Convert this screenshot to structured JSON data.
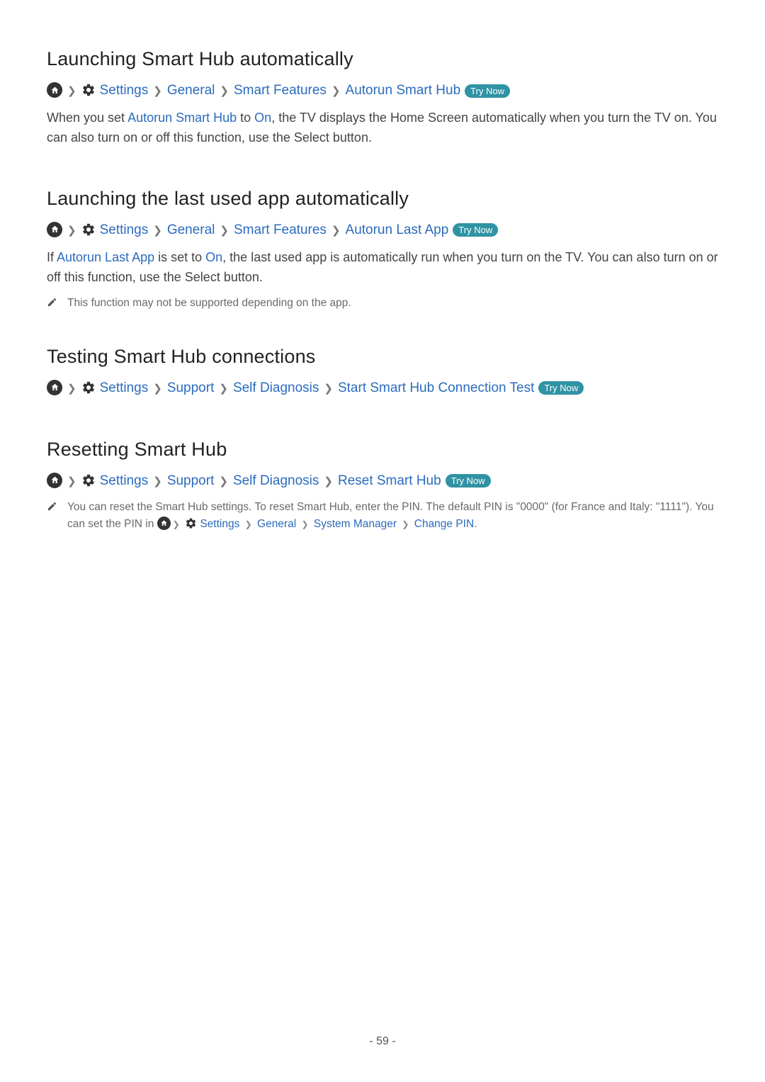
{
  "try_now_label": "Try Now",
  "page_number": "- 59 -",
  "nav": {
    "settings": "Settings",
    "general": "General",
    "support": "Support",
    "smart_features": "Smart Features",
    "self_diagnosis": "Self Diagnosis",
    "system_manager": "System Manager",
    "change_pin": "Change PIN"
  },
  "sec1": {
    "title": "Launching Smart Hub automatically",
    "crumb_last": "Autorun Smart Hub",
    "p1_a": "When you set ",
    "p1_link1": "Autorun Smart Hub",
    "p1_b": " to ",
    "p1_link2": "On",
    "p1_c": ", the TV displays the Home Screen automatically when you turn the TV on. You can also turn on or off this function, use the Select button."
  },
  "sec2": {
    "title": "Launching the last used app automatically",
    "crumb_last": "Autorun Last App",
    "p1_a": "If ",
    "p1_link1": "Autorun Last App",
    "p1_b": " is set to ",
    "p1_link2": "On",
    "p1_c": ", the last used app is automatically run when you turn on the TV. You can also turn on or off this function, use the Select button.",
    "note": "This function may not be supported depending on the app."
  },
  "sec3": {
    "title": "Testing Smart Hub connections",
    "crumb_last": "Start Smart Hub Connection Test"
  },
  "sec4": {
    "title": "Resetting Smart Hub",
    "crumb_last": "Reset Smart Hub",
    "note_a": "You can reset the Smart Hub settings. To reset Smart Hub, enter the PIN. The default PIN is \"0000\" (for France and Italy: \"1111\"). You can set the PIN in ",
    "note_b": "."
  }
}
